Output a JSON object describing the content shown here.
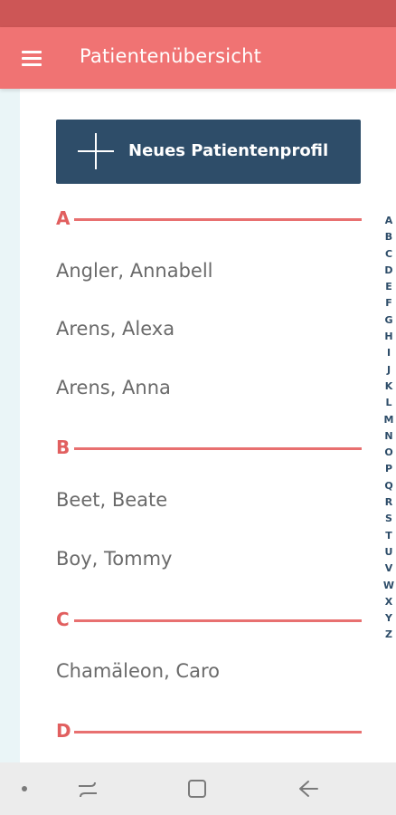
{
  "app_bar": {
    "title": "Patientenübersicht",
    "menu_icon": "hamburger-menu-icon"
  },
  "new_patient_button": {
    "label": "Neues Patientenprofil",
    "icon": "plus-icon"
  },
  "sections": [
    {
      "letter": "A",
      "patients": [
        "Angler, Annabell",
        "Arens, Alexa",
        "Arens, Anna"
      ]
    },
    {
      "letter": "B",
      "patients": [
        "Beet, Beate",
        "Boy, Tommy"
      ]
    },
    {
      "letter": "C",
      "patients": [
        "Chamäleon, Caro"
      ]
    },
    {
      "letter": "D",
      "patients": []
    }
  ],
  "alphabet_index": [
    "A",
    "B",
    "C",
    "D",
    "E",
    "F",
    "G",
    "H",
    "I",
    "J",
    "K",
    "L",
    "M",
    "N",
    "O",
    "P",
    "Q",
    "R",
    "S",
    "T",
    "U",
    "V",
    "W",
    "X",
    "Y",
    "Z"
  ],
  "navigation_bar": {
    "icons": [
      "dot-icon",
      "recents-icon",
      "home-icon",
      "back-icon"
    ]
  },
  "colors": {
    "status_bar": "#cd5656",
    "app_bar": "#f07373",
    "accent": "#e15f5f",
    "button": "#2e4d69",
    "patient_text": "#6a6a6a",
    "side_strip": "#eaf5f7"
  }
}
